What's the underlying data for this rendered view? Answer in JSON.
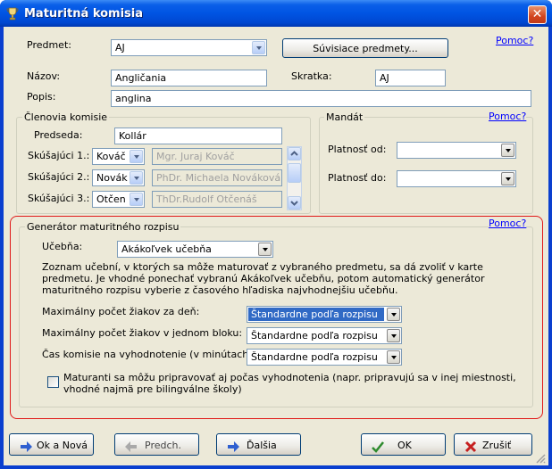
{
  "window": {
    "title": "Maturitná komisia",
    "close_glyph": "✕"
  },
  "top": {
    "predmet_label": "Predmet:",
    "predmet_value": "AJ",
    "suvisiace_button": "Súvisiace predmety...",
    "help_link": "Pomoc?",
    "nazov_label": "Názov:",
    "nazov_value": "Angličania",
    "skratka_label": "Skratka:",
    "skratka_value": "AJ",
    "popis_label": "Popis:",
    "popis_value": "anglina"
  },
  "commission": {
    "group_title": "Členovia komisie",
    "predseda_label": "Predseda:",
    "predseda_value": "Kollár",
    "rows": [
      {
        "label": "Skúšajúci 1.:",
        "short": "Kováč",
        "full": "Mgr. Juraj Kováč"
      },
      {
        "label": "Skúšajúci 2.:",
        "short": "Novák",
        "full": "PhDr. Michaela Nováková"
      },
      {
        "label": "Skúšajúci 3.:",
        "short": "Otčen",
        "full": "ThDr.Rudolf Otčenáš"
      }
    ]
  },
  "mandate": {
    "group_title": "Mandát",
    "help_link": "Pomoc?",
    "od_label": "Platnosť od:",
    "od_value": "",
    "do_label": "Platnosť do:",
    "do_value": ""
  },
  "generator": {
    "group_title": "Generátor maturitného rozpisu",
    "help_link": "Pomoc?",
    "ucebna_label": "Učebňa:",
    "ucebna_value": "Akákoľvek učebňa",
    "description": "Zoznam učební, v ktorých sa môže maturovať z vybraného predmetu, sa dá zvoliť v karte predmetu. Je vhodné ponechať vybranú Akákoľvek učebňu, potom automatický generátor maturitného rozpisu vyberie z časového hľadiska najvhodnejšiu učebňu.",
    "max_day_label": "Maximálny počet žiakov za deň:",
    "max_day_value": "Štandardne podľa rozpisu",
    "max_block_label": "Maximálny počet žiakov v jednom bloku:",
    "max_block_value": "Štandardne podľa rozpisu",
    "eval_label": "Čas komisie na vyhodnotenie (v minútach):",
    "eval_value": "Štandardne podľa rozpisu",
    "checkbox_label": "Maturanti sa môžu pripravovať aj počas vyhodnotenia (napr. pripravujú sa v inej miestnosti, vhodné najmä pre bilingválne školy)",
    "checkbox_checked": false
  },
  "buttons": {
    "ok_nova": "Ok a Nová",
    "predch": "Predch.",
    "dalsia": "Ďalšia",
    "ok": "OK",
    "zrusit": "Zrušiť"
  },
  "colors": {
    "title_bar": "#0054e3",
    "dialog_bg": "#ece9d8",
    "highlight_frame": "#e01818",
    "selection": "#316ac5",
    "link": "#0000ff"
  }
}
